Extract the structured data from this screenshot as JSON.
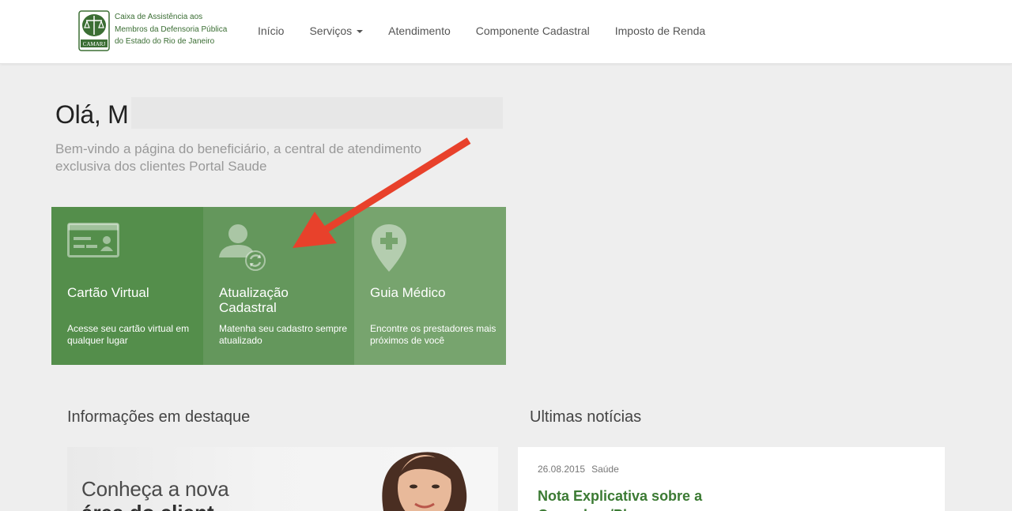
{
  "logo": {
    "text_lines": [
      "Caixa de Assistência aos",
      "Membros da Defensoria Pública",
      "do Estado do Rio de Janeiro"
    ],
    "brand": "CAMARJ"
  },
  "nav": {
    "items": [
      "Início",
      "Serviços",
      "Atendimento",
      "Componente Cadastral",
      "Imposto de Renda"
    ]
  },
  "greeting": {
    "text": "Olá, M",
    "welcome": "Bem-vindo a página do beneficiário, a central de atendimento exclusiva dos clientes Portal Saude"
  },
  "tiles": [
    {
      "title": "Cartão Virtual",
      "subtitle": "Acesse seu cartão virtual em qualquer lugar",
      "icon": "id-card-icon"
    },
    {
      "title": "Atualização Cadastral",
      "subtitle": "Matenha seu cadastro sempre atualizado",
      "icon": "user-refresh-icon"
    },
    {
      "title": "Guia Médico",
      "subtitle": "Encontre os prestadores mais próximos de você",
      "icon": "map-pin-plus-icon"
    }
  ],
  "sections": {
    "featured_title": "Informações em destaque",
    "news_title": "Ultimas notícias"
  },
  "featured": {
    "line1": "Conheça a nova",
    "line2": "área do client"
  },
  "news": {
    "date": "26.08.2015",
    "category": "Saúde",
    "title": "Nota Explicativa sobre a Operadora/Plano"
  },
  "colors": {
    "tile1": "#548e4b",
    "tile2": "#64975c",
    "tile3": "#77a46e",
    "accent": "#3b7a33",
    "arrow": "#e8412b"
  }
}
